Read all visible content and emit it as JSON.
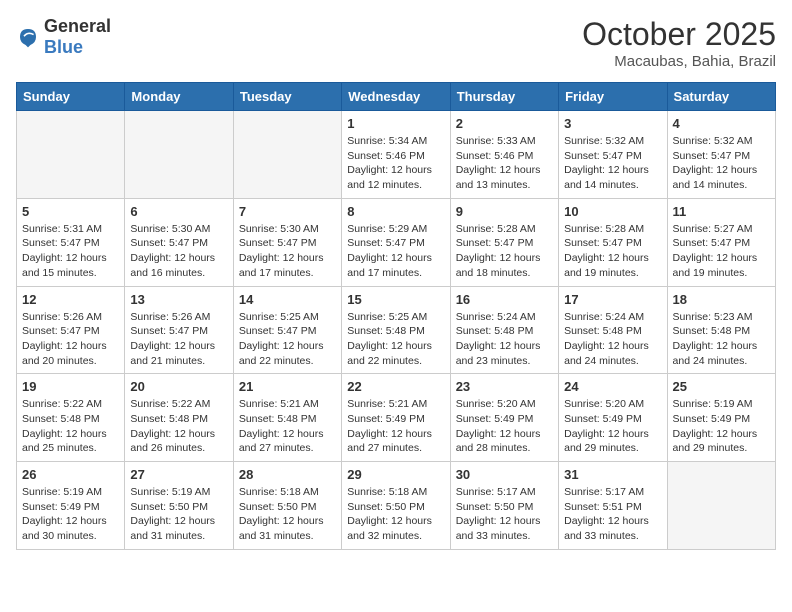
{
  "logo": {
    "general": "General",
    "blue": "Blue"
  },
  "header": {
    "month": "October 2025",
    "location": "Macaubas, Bahia, Brazil"
  },
  "weekdays": [
    "Sunday",
    "Monday",
    "Tuesday",
    "Wednesday",
    "Thursday",
    "Friday",
    "Saturday"
  ],
  "weeks": [
    [
      {
        "day": "",
        "sunrise": "",
        "sunset": "",
        "daylight": ""
      },
      {
        "day": "",
        "sunrise": "",
        "sunset": "",
        "daylight": ""
      },
      {
        "day": "",
        "sunrise": "",
        "sunset": "",
        "daylight": ""
      },
      {
        "day": "1",
        "sunrise": "Sunrise: 5:34 AM",
        "sunset": "Sunset: 5:46 PM",
        "daylight": "Daylight: 12 hours and 12 minutes."
      },
      {
        "day": "2",
        "sunrise": "Sunrise: 5:33 AM",
        "sunset": "Sunset: 5:46 PM",
        "daylight": "Daylight: 12 hours and 13 minutes."
      },
      {
        "day": "3",
        "sunrise": "Sunrise: 5:32 AM",
        "sunset": "Sunset: 5:47 PM",
        "daylight": "Daylight: 12 hours and 14 minutes."
      },
      {
        "day": "4",
        "sunrise": "Sunrise: 5:32 AM",
        "sunset": "Sunset: 5:47 PM",
        "daylight": "Daylight: 12 hours and 14 minutes."
      }
    ],
    [
      {
        "day": "5",
        "sunrise": "Sunrise: 5:31 AM",
        "sunset": "Sunset: 5:47 PM",
        "daylight": "Daylight: 12 hours and 15 minutes."
      },
      {
        "day": "6",
        "sunrise": "Sunrise: 5:30 AM",
        "sunset": "Sunset: 5:47 PM",
        "daylight": "Daylight: 12 hours and 16 minutes."
      },
      {
        "day": "7",
        "sunrise": "Sunrise: 5:30 AM",
        "sunset": "Sunset: 5:47 PM",
        "daylight": "Daylight: 12 hours and 17 minutes."
      },
      {
        "day": "8",
        "sunrise": "Sunrise: 5:29 AM",
        "sunset": "Sunset: 5:47 PM",
        "daylight": "Daylight: 12 hours and 17 minutes."
      },
      {
        "day": "9",
        "sunrise": "Sunrise: 5:28 AM",
        "sunset": "Sunset: 5:47 PM",
        "daylight": "Daylight: 12 hours and 18 minutes."
      },
      {
        "day": "10",
        "sunrise": "Sunrise: 5:28 AM",
        "sunset": "Sunset: 5:47 PM",
        "daylight": "Daylight: 12 hours and 19 minutes."
      },
      {
        "day": "11",
        "sunrise": "Sunrise: 5:27 AM",
        "sunset": "Sunset: 5:47 PM",
        "daylight": "Daylight: 12 hours and 19 minutes."
      }
    ],
    [
      {
        "day": "12",
        "sunrise": "Sunrise: 5:26 AM",
        "sunset": "Sunset: 5:47 PM",
        "daylight": "Daylight: 12 hours and 20 minutes."
      },
      {
        "day": "13",
        "sunrise": "Sunrise: 5:26 AM",
        "sunset": "Sunset: 5:47 PM",
        "daylight": "Daylight: 12 hours and 21 minutes."
      },
      {
        "day": "14",
        "sunrise": "Sunrise: 5:25 AM",
        "sunset": "Sunset: 5:47 PM",
        "daylight": "Daylight: 12 hours and 22 minutes."
      },
      {
        "day": "15",
        "sunrise": "Sunrise: 5:25 AM",
        "sunset": "Sunset: 5:48 PM",
        "daylight": "Daylight: 12 hours and 22 minutes."
      },
      {
        "day": "16",
        "sunrise": "Sunrise: 5:24 AM",
        "sunset": "Sunset: 5:48 PM",
        "daylight": "Daylight: 12 hours and 23 minutes."
      },
      {
        "day": "17",
        "sunrise": "Sunrise: 5:24 AM",
        "sunset": "Sunset: 5:48 PM",
        "daylight": "Daylight: 12 hours and 24 minutes."
      },
      {
        "day": "18",
        "sunrise": "Sunrise: 5:23 AM",
        "sunset": "Sunset: 5:48 PM",
        "daylight": "Daylight: 12 hours and 24 minutes."
      }
    ],
    [
      {
        "day": "19",
        "sunrise": "Sunrise: 5:22 AM",
        "sunset": "Sunset: 5:48 PM",
        "daylight": "Daylight: 12 hours and 25 minutes."
      },
      {
        "day": "20",
        "sunrise": "Sunrise: 5:22 AM",
        "sunset": "Sunset: 5:48 PM",
        "daylight": "Daylight: 12 hours and 26 minutes."
      },
      {
        "day": "21",
        "sunrise": "Sunrise: 5:21 AM",
        "sunset": "Sunset: 5:48 PM",
        "daylight": "Daylight: 12 hours and 27 minutes."
      },
      {
        "day": "22",
        "sunrise": "Sunrise: 5:21 AM",
        "sunset": "Sunset: 5:49 PM",
        "daylight": "Daylight: 12 hours and 27 minutes."
      },
      {
        "day": "23",
        "sunrise": "Sunrise: 5:20 AM",
        "sunset": "Sunset: 5:49 PM",
        "daylight": "Daylight: 12 hours and 28 minutes."
      },
      {
        "day": "24",
        "sunrise": "Sunrise: 5:20 AM",
        "sunset": "Sunset: 5:49 PM",
        "daylight": "Daylight: 12 hours and 29 minutes."
      },
      {
        "day": "25",
        "sunrise": "Sunrise: 5:19 AM",
        "sunset": "Sunset: 5:49 PM",
        "daylight": "Daylight: 12 hours and 29 minutes."
      }
    ],
    [
      {
        "day": "26",
        "sunrise": "Sunrise: 5:19 AM",
        "sunset": "Sunset: 5:49 PM",
        "daylight": "Daylight: 12 hours and 30 minutes."
      },
      {
        "day": "27",
        "sunrise": "Sunrise: 5:19 AM",
        "sunset": "Sunset: 5:50 PM",
        "daylight": "Daylight: 12 hours and 31 minutes."
      },
      {
        "day": "28",
        "sunrise": "Sunrise: 5:18 AM",
        "sunset": "Sunset: 5:50 PM",
        "daylight": "Daylight: 12 hours and 31 minutes."
      },
      {
        "day": "29",
        "sunrise": "Sunrise: 5:18 AM",
        "sunset": "Sunset: 5:50 PM",
        "daylight": "Daylight: 12 hours and 32 minutes."
      },
      {
        "day": "30",
        "sunrise": "Sunrise: 5:17 AM",
        "sunset": "Sunset: 5:50 PM",
        "daylight": "Daylight: 12 hours and 33 minutes."
      },
      {
        "day": "31",
        "sunrise": "Sunrise: 5:17 AM",
        "sunset": "Sunset: 5:51 PM",
        "daylight": "Daylight: 12 hours and 33 minutes."
      },
      {
        "day": "",
        "sunrise": "",
        "sunset": "",
        "daylight": ""
      }
    ]
  ]
}
